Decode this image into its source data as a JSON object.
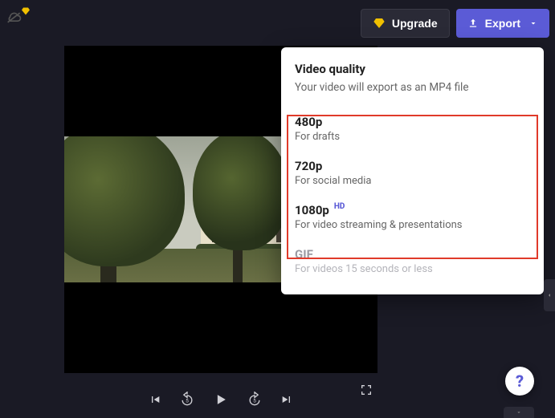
{
  "header": {
    "upgrade_label": "Upgrade",
    "export_label": "Export"
  },
  "export_popover": {
    "title": "Video quality",
    "subtitle": "Your video will export as an MP4 file",
    "options": [
      {
        "label": "480p",
        "desc": "For drafts",
        "badge": ""
      },
      {
        "label": "720p",
        "desc": "For social media",
        "badge": ""
      },
      {
        "label": "1080p",
        "desc": "For video streaming & presentations",
        "badge": "HD"
      },
      {
        "label": "GIF",
        "desc": "For videos 15 seconds or less",
        "badge": ""
      }
    ]
  },
  "help": {
    "label": "?"
  }
}
